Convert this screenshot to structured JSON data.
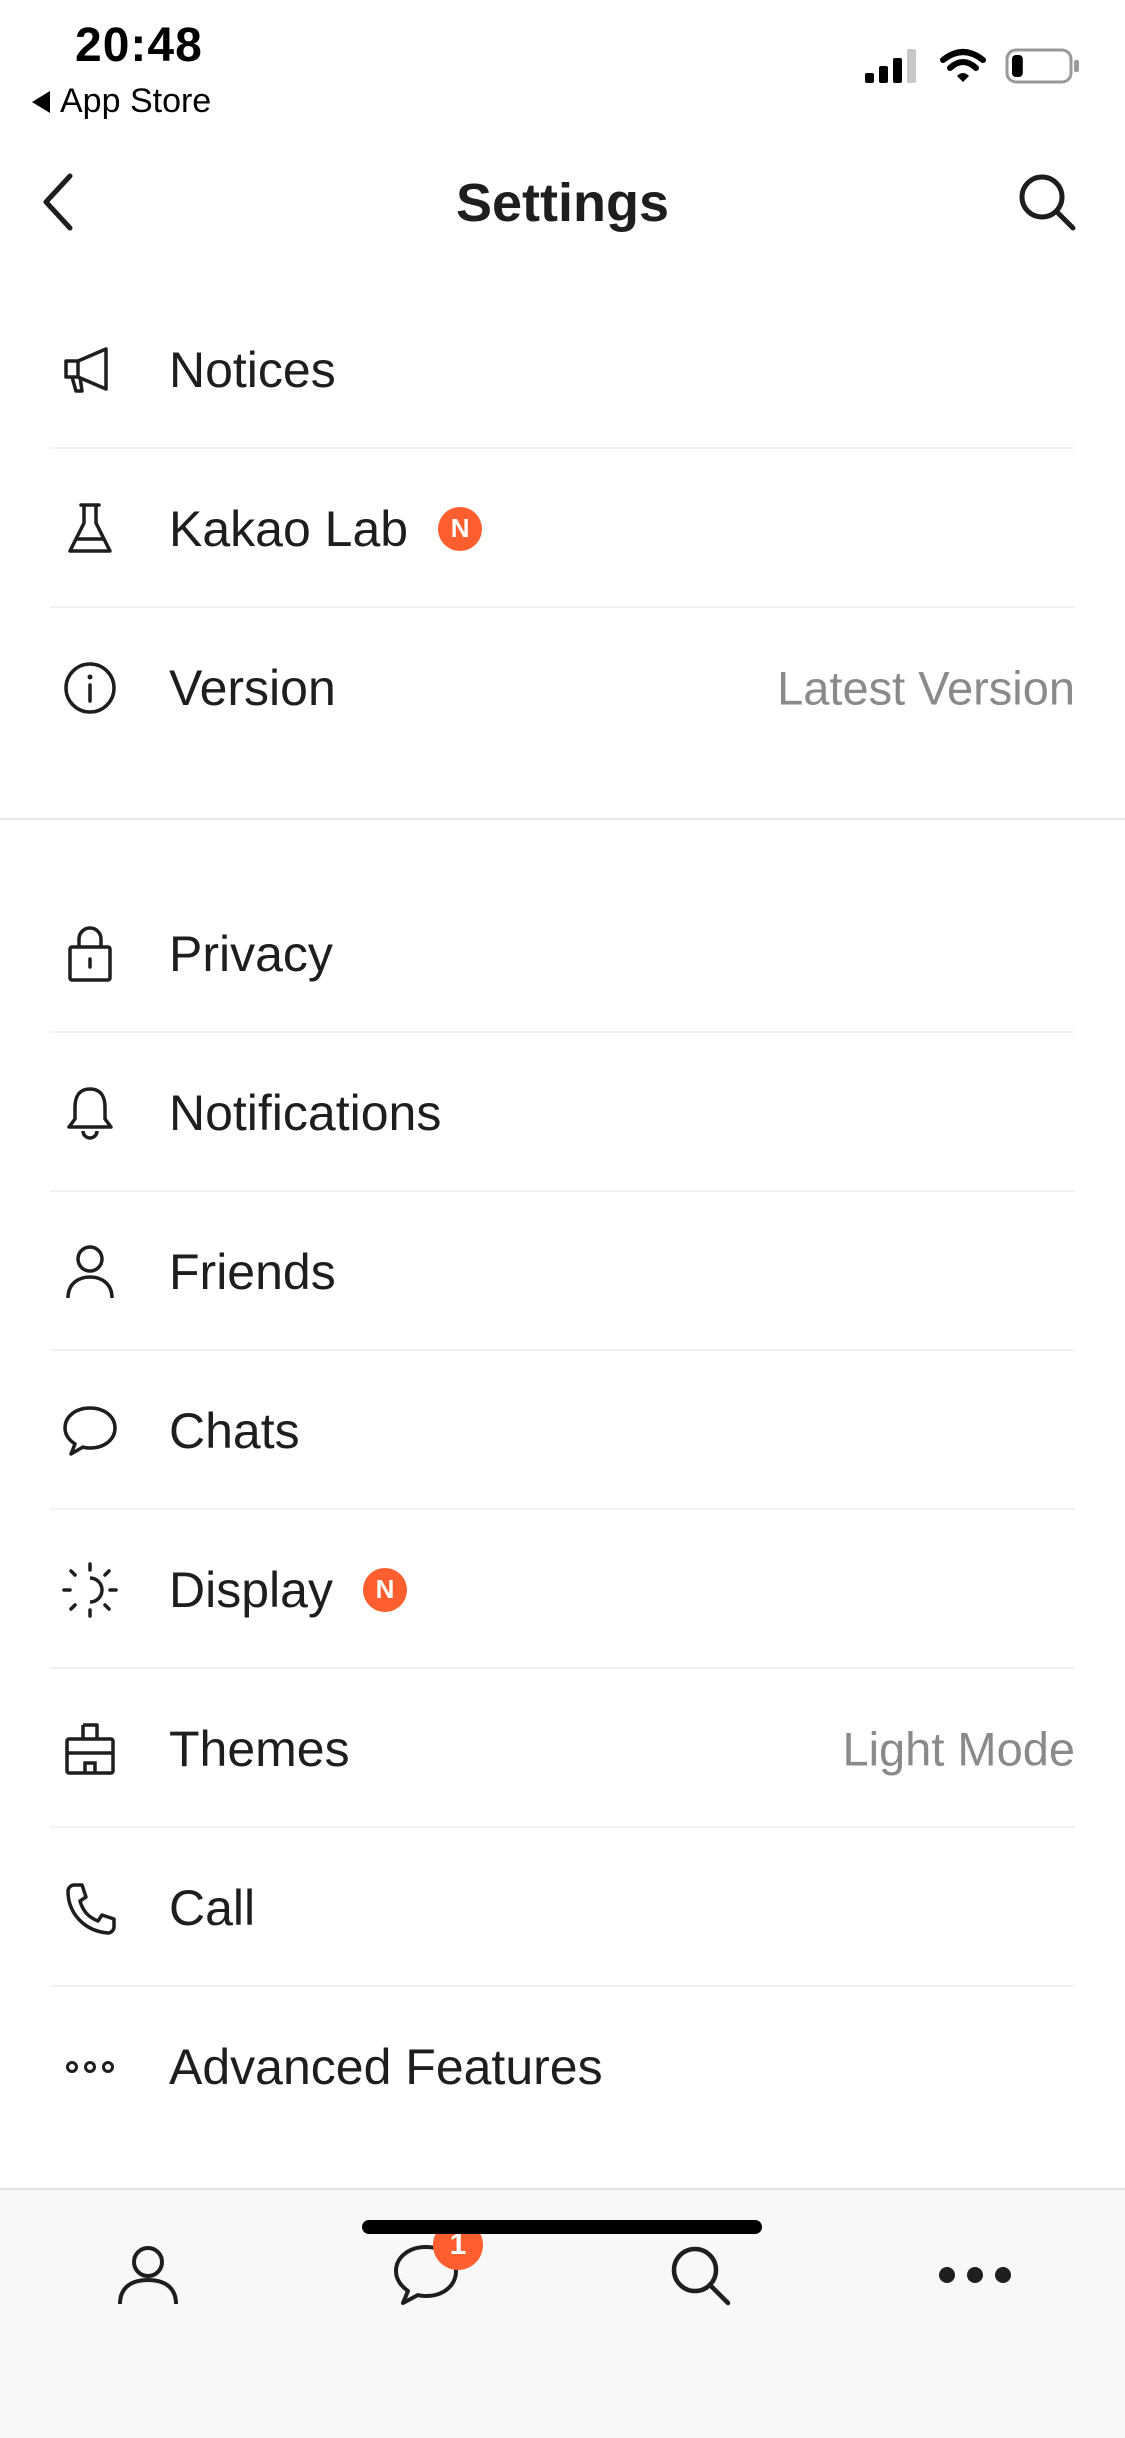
{
  "status_bar": {
    "time": "20:48",
    "back_app": "App Store",
    "signal_icon": "cellular-signal-icon",
    "wifi_icon": "wifi-icon",
    "battery_icon": "battery-icon",
    "battery_level": 0.2
  },
  "header": {
    "title": "Settings",
    "back_icon": "chevron-left-icon",
    "search_icon": "search-icon"
  },
  "sections": [
    {
      "items": [
        {
          "label": "Notices",
          "icon": "megaphone-icon"
        },
        {
          "label": "Kakao Lab",
          "icon": "flask-icon",
          "badge": "N"
        },
        {
          "label": "Version",
          "icon": "info-icon",
          "value": "Latest Version"
        }
      ]
    },
    {
      "items": [
        {
          "label": "Privacy",
          "icon": "lock-icon"
        },
        {
          "label": "Notifications",
          "icon": "bell-icon"
        },
        {
          "label": "Friends",
          "icon": "person-icon"
        },
        {
          "label": "Chats",
          "icon": "chat-bubble-icon"
        },
        {
          "label": "Display",
          "icon": "brightness-icon",
          "badge": "N"
        },
        {
          "label": "Themes",
          "icon": "theme-brush-icon",
          "value": "Light Mode"
        },
        {
          "label": "Call",
          "icon": "phone-icon"
        },
        {
          "label": "Advanced Features",
          "icon": "more-dots-icon"
        }
      ]
    }
  ],
  "tab_bar": {
    "tabs": [
      {
        "name": "friends",
        "icon": "person-icon"
      },
      {
        "name": "chats",
        "icon": "chat-bubble-icon",
        "badge": "1"
      },
      {
        "name": "search",
        "icon": "search-icon"
      },
      {
        "name": "more",
        "icon": "more-dots-icon"
      }
    ]
  },
  "colors": {
    "badge": "#ff5f2e",
    "text": "#1e1e1e",
    "secondary_text": "#8a8a8a",
    "tab_bar_bg": "#f8f8f8"
  }
}
